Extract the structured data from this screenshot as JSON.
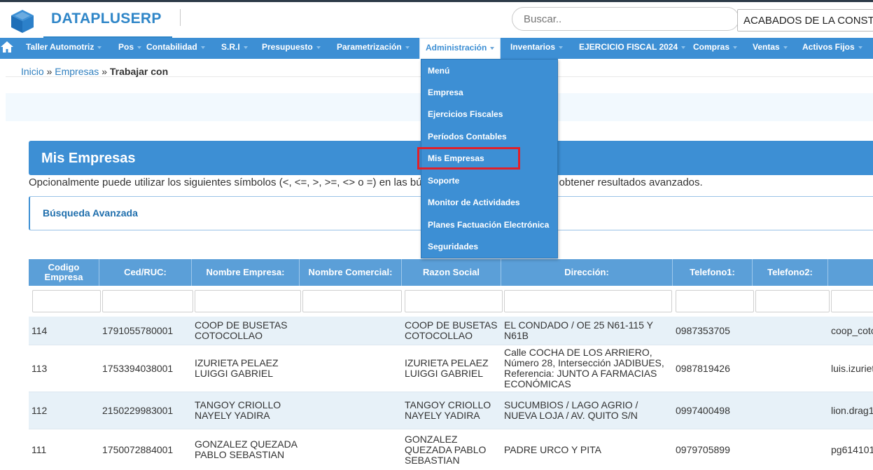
{
  "app": {
    "brand": "DATAPLUSERP",
    "logo_icon": "cube-icon"
  },
  "header": {
    "search_placeholder": "Buscar..",
    "company_selected": "ACABADOS DE LA CONSTRUCCION"
  },
  "colors": {
    "primary": "#3d8fd4",
    "brand": "#2f86c8",
    "highlight_border": "#e0202a"
  },
  "nav": {
    "home_icon": "home-icon",
    "items": [
      {
        "label": "Taller Automotriz"
      },
      {
        "label": "Pos"
      },
      {
        "label": "Contabilidad"
      },
      {
        "label": "S.R.I"
      },
      {
        "label": "Presupuesto"
      },
      {
        "label": "Parametrización"
      },
      {
        "label": "Administración"
      },
      {
        "label": "Inventarios"
      },
      {
        "label": "EJERCICIO FISCAL 2024"
      },
      {
        "label": "Compras"
      },
      {
        "label": "Ventas"
      },
      {
        "label": "Activos Fijos"
      }
    ],
    "active_index": 6
  },
  "dropdown": {
    "items": [
      "Menú",
      "Empresa",
      "Ejercicios Fiscales",
      "Períodos Contables",
      "Mis Empresas",
      "Soporte",
      "Monitor de Actividades",
      "Planes Factuación Electrónica",
      "Seguridades"
    ],
    "highlighted_index": 4
  },
  "breadcrumb": {
    "home": "Inicio",
    "sep1": "»",
    "section": "Empresas",
    "sep2": "»",
    "current": "Trabajar con"
  },
  "panel": {
    "title": "Mis Empresas",
    "hint": "Opcionalmente puede utilizar los siguientes símbolos (<, <=, >, >=, <> o =) en las búsquedas de los campos para obtener resultados avanzados.",
    "advanced_search": "Búsqueda Avanzada"
  },
  "table": {
    "columns": [
      "Codigo Empresa",
      "Ced/RUC:",
      "Nombre Empresa:",
      "Nombre Comercial:",
      "Razon Social",
      "Dirección:",
      "Telefono1:",
      "Telefono2:",
      ""
    ],
    "rows": [
      {
        "codigo": "114",
        "ruc": "1791055780001",
        "nombre": "COOP DE BUSETAS COTOCOLLAO",
        "comercial": "",
        "razon": "COOP DE BUSETAS COTOCOLLAO",
        "direccion": "EL CONDADO / OE 25 N61-115 Y N61B",
        "tel1": "0987353705",
        "tel2": "",
        "email": "coop_cotocollao"
      },
      {
        "codigo": "113",
        "ruc": "1753394038001",
        "nombre": "IZURIETA PELAEZ LUIGGI GABRIEL",
        "comercial": "",
        "razon": "IZURIETA PELAEZ LUIGGI GABRIEL",
        "direccion": "Calle COCHA DE LOS ARRIERO, Número 28, Intersección JADIBUES, Referencia: JUNTO A FARMACIAS ECONÓMICAS",
        "tel1": "0987819426",
        "tel2": "",
        "email": "luis.izurieta"
      },
      {
        "codigo": "112",
        "ruc": "2150229983001",
        "nombre": "TANGOY CRIOLLO NAYELY YADIRA",
        "comercial": "",
        "razon": "TANGOY CRIOLLO NAYELY YADIRA",
        "direccion": "SUCUMBIOS / LAGO AGRIO / NUEVA LOJA / AV. QUITO S/N",
        "tel1": "0997400498",
        "tel2": "",
        "email": "lion.drag1"
      },
      {
        "codigo": "111",
        "ruc": "1750072884001",
        "nombre": "GONZALEZ QUEZADA PABLO SEBASTIAN",
        "comercial": "",
        "razon": "GONZALEZ QUEZADA PABLO SEBASTIAN",
        "direccion": "PADRE URCO Y PITA",
        "tel1": "0979705899",
        "tel2": "",
        "email": "pg614101"
      }
    ]
  }
}
